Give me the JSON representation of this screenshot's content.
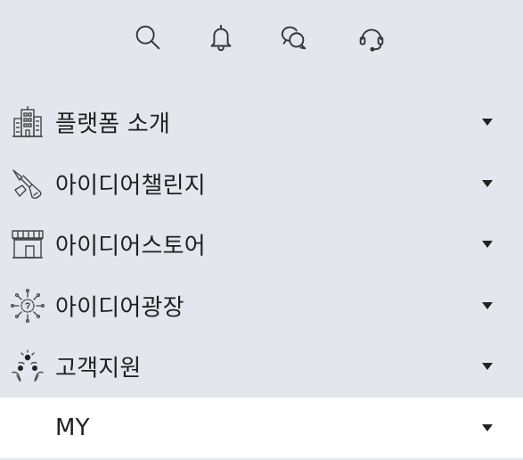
{
  "top_icons": [
    {
      "name": "search-icon"
    },
    {
      "name": "bell-icon"
    },
    {
      "name": "chat-icon"
    },
    {
      "name": "headset-icon"
    }
  ],
  "menu": {
    "items": [
      {
        "label": "플랫폼 소개",
        "icon": "building-icon",
        "active": false
      },
      {
        "label": "아이디어챌린지",
        "icon": "brush-icon",
        "active": false
      },
      {
        "label": "아이디어스토어",
        "icon": "store-icon",
        "active": false
      },
      {
        "label": "아이디어광장",
        "icon": "idea-bulb-icon",
        "active": false
      },
      {
        "label": "고객지원",
        "icon": "support-people-icon",
        "active": false
      },
      {
        "label": "MY",
        "icon": "",
        "active": true
      }
    ]
  },
  "colors": {
    "background": "#e3e6ed",
    "active_item": "#ffffff",
    "text": "#1f1f1f"
  }
}
